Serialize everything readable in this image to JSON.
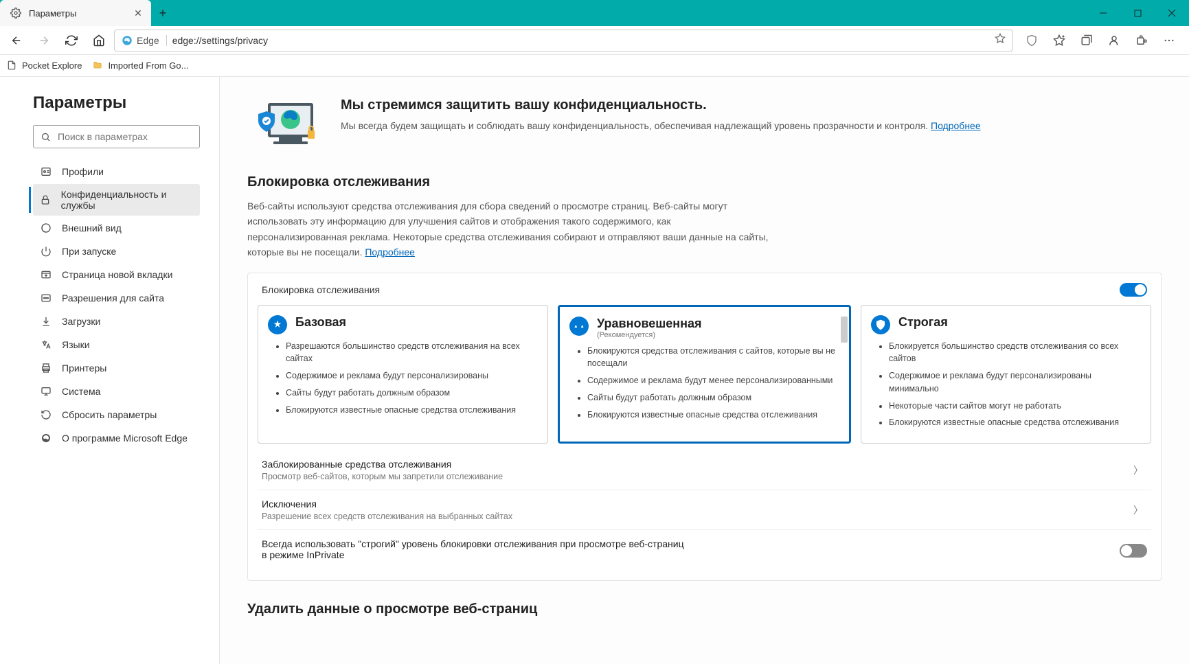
{
  "tab": {
    "title": "Параметры"
  },
  "addressbar": {
    "brand": "Edge",
    "url": "edge://settings/privacy"
  },
  "bookmarks": [
    {
      "label": "Pocket Explore",
      "icon": "page"
    },
    {
      "label": "Imported From Go...",
      "icon": "folder"
    }
  ],
  "sidebar": {
    "title": "Параметры",
    "search_placeholder": "Поиск в параметрах",
    "items": [
      {
        "label": "Профили",
        "icon": "profile"
      },
      {
        "label": "Конфиденциальность и службы",
        "icon": "lock",
        "active": true
      },
      {
        "label": "Внешний вид",
        "icon": "appearance"
      },
      {
        "label": "При запуске",
        "icon": "power"
      },
      {
        "label": "Страница новой вкладки",
        "icon": "newtab"
      },
      {
        "label": "Разрешения для сайта",
        "icon": "permissions"
      },
      {
        "label": "Загрузки",
        "icon": "download"
      },
      {
        "label": "Языки",
        "icon": "language"
      },
      {
        "label": "Принтеры",
        "icon": "printer"
      },
      {
        "label": "Система",
        "icon": "system"
      },
      {
        "label": "Сбросить параметры",
        "icon": "reset"
      },
      {
        "label": "О программе Microsoft Edge",
        "icon": "edge"
      }
    ]
  },
  "hero": {
    "title": "Мы стремимся защитить вашу конфиденциальность.",
    "desc": "Мы всегда будем защищать и соблюдать вашу конфиденциальность, обеспечивая надлежащий уровень прозрачности и контроля. ",
    "link": "Подробнее"
  },
  "tracking": {
    "title": "Блокировка отслеживания",
    "desc": "Веб-сайты используют средства отслеживания для сбора сведений о просмотре страниц. Веб-сайты могут использовать эту информацию для улучшения сайтов и отображения такого содержимого, как персонализированная реклама. Некоторые средства отслеживания собирают и отправляют ваши данные на сайты, которые вы не посещали. ",
    "link": "Подробнее",
    "toggle_label": "Блокировка отслеживания",
    "levels": {
      "basic": {
        "title": "Базовая",
        "bullets": [
          "Разрешаются большинство средств отслеживания на всех сайтах",
          "Содержимое и реклама будут персонализированы",
          "Сайты будут работать должным образом",
          "Блокируются известные опасные средства отслеживания"
        ]
      },
      "balanced": {
        "title": "Уравновешенная",
        "reco": "(Рекомендуется)",
        "bullets": [
          "Блокируются средства отслеживания с сайтов, которые вы не посещали",
          "Содержимое и реклама будут менее персонализированными",
          "Сайты будут работать должным образом",
          "Блокируются известные опасные средства отслеживания"
        ]
      },
      "strict": {
        "title": "Строгая",
        "bullets": [
          "Блокируется большинство средств отслеживания со всех сайтов",
          "Содержимое и реклама будут персонализированы минимально",
          "Некоторые части сайтов могут не работать",
          "Блокируются известные опасные средства отслеживания"
        ]
      }
    },
    "blocked": {
      "title": "Заблокированные средства отслеживания",
      "desc": "Просмотр веб-сайтов, которым мы запретили отслеживание"
    },
    "exceptions": {
      "title": "Исключения",
      "desc": "Разрешение всех средств отслеживания на выбранных сайтах"
    },
    "inprivate": "Всегда использовать \"строгий\" уровень блокировки отслеживания при просмотре веб-страниц в режиме InPrivate"
  },
  "clear": {
    "title": "Удалить данные о просмотре веб-страниц"
  }
}
